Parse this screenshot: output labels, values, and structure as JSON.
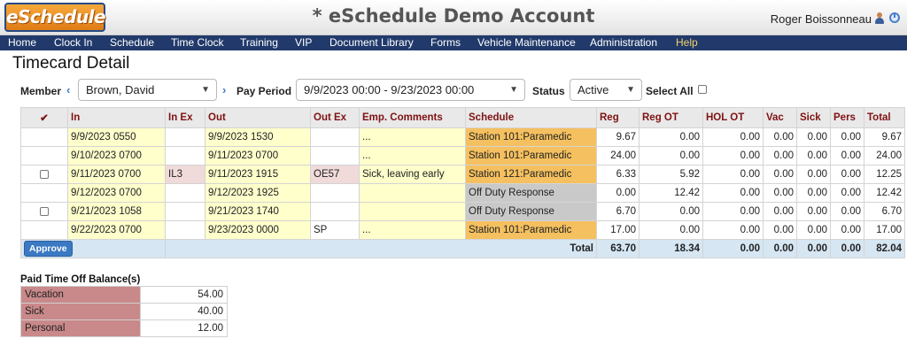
{
  "header": {
    "logo": "eSchedule",
    "title": "* eSchedule Demo Account",
    "user": "Roger Boissonneau"
  },
  "nav": {
    "items": [
      "Home",
      "Clock In",
      "Schedule",
      "Time Clock",
      "Training",
      "VIP",
      "Document Library",
      "Forms",
      "Vehicle Maintenance",
      "Administration",
      "Help"
    ]
  },
  "page": {
    "title": "Timecard Detail"
  },
  "filters": {
    "member_label": "Member",
    "member_value": "Brown, David",
    "pay_period_label": "Pay Period",
    "pay_period_value": "9/9/2023 00:00 - 9/23/2023 00:00",
    "status_label": "Status",
    "status_value": "Active",
    "select_all_label": "Select All"
  },
  "timecard": {
    "headers": [
      "In",
      "In Ex",
      "Out",
      "Out Ex",
      "Emp. Comments",
      "Schedule",
      "Reg",
      "Reg OT",
      "HOL OT",
      "Vac",
      "Sick",
      "Pers",
      "Total"
    ],
    "rows": [
      {
        "checkbox": false,
        "in": "9/9/2023 0550",
        "in_ex": "",
        "out": "9/9/2023 1530",
        "out_ex": "",
        "comments": "...",
        "schedule": "Station 101:Paramedic",
        "schedule_type": "paramedic",
        "reg": "9.67",
        "reg_ot": "0.00",
        "hol_ot": "0.00",
        "vac": "0.00",
        "sick": "0.00",
        "pers": "0.00",
        "total": "9.67"
      },
      {
        "checkbox": false,
        "in": "9/10/2023 0700",
        "in_ex": "",
        "out": "9/11/2023 0700",
        "out_ex": "",
        "comments": "...",
        "schedule": "Station 101:Paramedic",
        "schedule_type": "paramedic",
        "reg": "24.00",
        "reg_ot": "0.00",
        "hol_ot": "0.00",
        "vac": "0.00",
        "sick": "0.00",
        "pers": "0.00",
        "total": "24.00"
      },
      {
        "checkbox": true,
        "in": "9/11/2023 0700",
        "in_ex": "IL3",
        "out": "9/11/2023 1915",
        "out_ex": "OE57",
        "comments": "Sick, leaving early",
        "schedule": "Station 121:Paramedic",
        "schedule_type": "paramedic",
        "reg": "6.33",
        "reg_ot": "5.92",
        "hol_ot": "0.00",
        "vac": "0.00",
        "sick": "0.00",
        "pers": "0.00",
        "total": "12.25"
      },
      {
        "checkbox": false,
        "in": "9/12/2023 0700",
        "in_ex": "",
        "out": "9/12/2023 1925",
        "out_ex": "",
        "comments": "",
        "schedule": "Off Duty Response",
        "schedule_type": "off",
        "reg": "0.00",
        "reg_ot": "12.42",
        "hol_ot": "0.00",
        "vac": "0.00",
        "sick": "0.00",
        "pers": "0.00",
        "total": "12.42"
      },
      {
        "checkbox": true,
        "in": "9/21/2023 1058",
        "in_ex": "",
        "out": "9/21/2023 1740",
        "out_ex": "",
        "comments": "",
        "schedule": "Off Duty Response",
        "schedule_type": "off",
        "reg": "6.70",
        "reg_ot": "0.00",
        "hol_ot": "0.00",
        "vac": "0.00",
        "sick": "0.00",
        "pers": "0.00",
        "total": "6.70"
      },
      {
        "checkbox": false,
        "in": "9/22/2023 0700",
        "in_ex": "",
        "out": "9/23/2023 0000",
        "out_ex": "SP",
        "comments": "...",
        "schedule": "Station 101:Paramedic",
        "schedule_type": "paramedic",
        "reg": "17.00",
        "reg_ot": "0.00",
        "hol_ot": "0.00",
        "vac": "0.00",
        "sick": "0.00",
        "pers": "0.00",
        "total": "17.00"
      }
    ],
    "approve_label": "Approve",
    "total_label": "Total",
    "totals": {
      "reg": "63.70",
      "reg_ot": "18.34",
      "hol_ot": "0.00",
      "vac": "0.00",
      "sick": "0.00",
      "pers": "0.00",
      "total": "82.04"
    }
  },
  "pto": {
    "title": "Paid Time Off Balance(s)",
    "rows": [
      {
        "label": "Vacation",
        "value": "54.00"
      },
      {
        "label": "Sick",
        "value": "40.00"
      },
      {
        "label": "Personal",
        "value": "12.00"
      }
    ]
  },
  "colors": {
    "nav_bg": "#213a6b",
    "header_text": "#7f1212",
    "highlight": "#ffffcc",
    "paramedic": "#f5c05f",
    "off_duty": "#c9c9c9",
    "exception": "#f0dada",
    "total_row": "#d6e6f3",
    "pto_label": "#c9898a",
    "approve": "#3b79c3"
  },
  "icons": {
    "user": "user-icon",
    "power": "power-icon",
    "prev": "chevron-left-icon",
    "next": "chevron-right-icon",
    "dropdown": "chevron-down-icon",
    "check": "checkmark-icon"
  }
}
